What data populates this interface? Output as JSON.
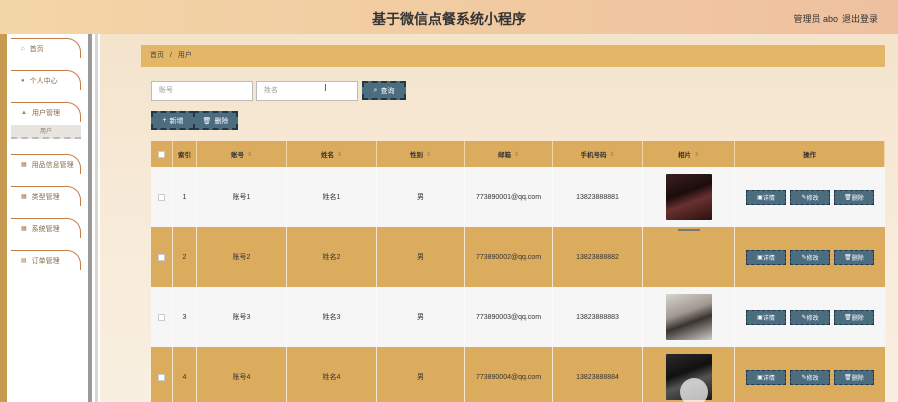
{
  "header": {
    "title": "基于微信点餐系统小程序",
    "user": "管理员 abo",
    "logout": "退出登录"
  },
  "sidebar": {
    "items": [
      {
        "label": "首页",
        "icon": "home-icon"
      },
      {
        "label": "个人中心",
        "icon": "person-icon"
      },
      {
        "label": "用户管理",
        "icon": "users-icon"
      },
      {
        "label": "用户",
        "icon": ""
      },
      {
        "label": "用品信息管理",
        "icon": "grid-icon"
      },
      {
        "label": "类型管理",
        "icon": "grid-icon"
      },
      {
        "label": "系统管理",
        "icon": "grid-icon"
      },
      {
        "label": "订单管理",
        "icon": "order-icon"
      }
    ]
  },
  "breadcrumb": {
    "home": "首页",
    "sep": "/",
    "current": "用户"
  },
  "search": {
    "account_placeholder": "账号",
    "name_placeholder": "姓名",
    "query_label": "查询",
    "add_label": "新增",
    "delete_label": "删除"
  },
  "table": {
    "headers": [
      "",
      "索引",
      "账号",
      "姓名",
      "性别",
      "邮箱",
      "手机号码",
      "相片",
      "操作"
    ],
    "rows": [
      {
        "index": "1",
        "account": "账号1",
        "name": "姓名1",
        "gender": "男",
        "email": "773890001@qq.com",
        "phone": "13823888881",
        "photo": "portrait-woman"
      },
      {
        "index": "2",
        "account": "账号2",
        "name": "姓名2",
        "gender": "男",
        "email": "773890002@qq.com",
        "phone": "13823888882",
        "photo": ""
      },
      {
        "index": "3",
        "account": "账号3",
        "name": "姓名3",
        "gender": "男",
        "email": "773890003@qq.com",
        "phone": "13823888883",
        "photo": "portrait-man"
      },
      {
        "index": "4",
        "account": "账号4",
        "name": "姓名4",
        "gender": "男",
        "email": "773890004@qq.com",
        "phone": "13823888884",
        "photo": "portrait-man-dark"
      }
    ],
    "actions": {
      "detail": "详情",
      "edit": "修改",
      "delete": "删除"
    }
  },
  "colors": {
    "accent": "#dcac5e",
    "button": "#4c6d80",
    "header_gradient_start": "#f3d6a8"
  }
}
